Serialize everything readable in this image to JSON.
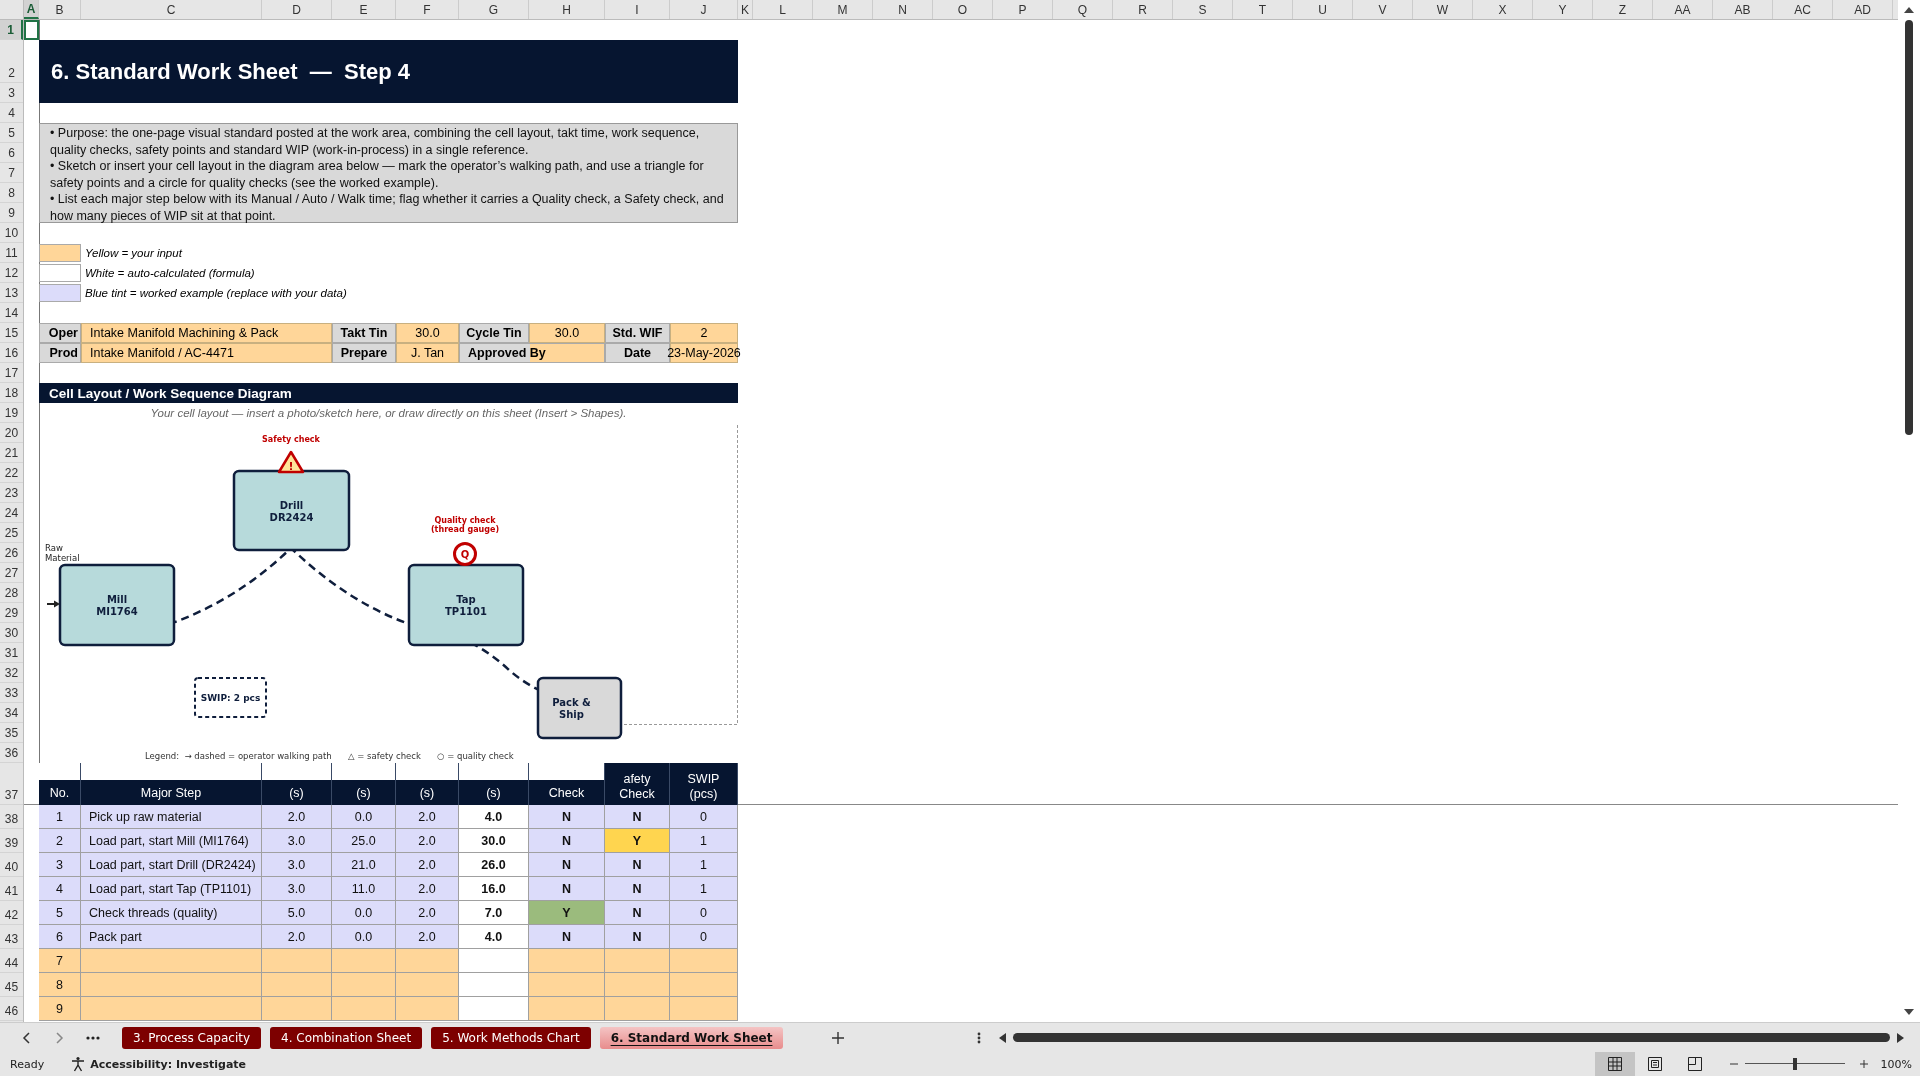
{
  "columns": [
    "A",
    "B",
    "C",
    "D",
    "E",
    "F",
    "G",
    "H",
    "I",
    "J",
    "K",
    "L",
    "M",
    "N",
    "O",
    "P",
    "Q",
    "R",
    "S",
    "T",
    "U",
    "V",
    "W",
    "X",
    "Y",
    "Z",
    "AA",
    "AB",
    "AC",
    "AD"
  ],
  "row_numbers": [
    "1",
    "2",
    "3",
    "4",
    "5",
    "6",
    "7",
    "8",
    "9",
    "10",
    "11",
    "12",
    "13",
    "14",
    "15",
    "16",
    "17",
    "18",
    "19",
    "20",
    "21",
    "22",
    "23",
    "24",
    "25",
    "26",
    "27",
    "28",
    "29",
    "30",
    "31",
    "32",
    "33",
    "34",
    "35",
    "36",
    "37",
    "38",
    "39",
    "40",
    "41",
    "42",
    "43",
    "44",
    "45",
    "46"
  ],
  "title": "6. Standard Work Sheet  —  Step 4",
  "instructions": [
    "•  Purpose: the one-page visual standard posted at the work area, combining the cell layout, takt time, work sequence, quality checks, safety points and standard WIP (work-in-process) in a single reference.",
    "•  Sketch or insert your cell layout in the diagram area below — mark the operator’s walking path, and use a triangle for safety points and a circle for quality checks (see the worked example).",
    "•  List each major step below with its Manual / Auto / Walk time; flag whether it carries a Quality check, a Safety check, and how many pieces of WIP sit at that point."
  ],
  "color_key": [
    {
      "color": "#ffd699",
      "text": "Yellow = your input"
    },
    {
      "color": "#ffffff",
      "text": "White = auto-calculated (formula)"
    },
    {
      "color": "#dcdcfa",
      "text": "Blue tint = worked example (replace with your data)"
    }
  ],
  "info_rows": [
    [
      {
        "label": "Oper",
        "value": "Intake Manifold Machining & Pack"
      },
      {
        "label": "Takt Tin",
        "value": "30.0"
      },
      {
        "label": "Cycle Tin",
        "value": "30.0"
      },
      {
        "label": "Std. WIF",
        "value": "2"
      }
    ],
    [
      {
        "label": "Prod",
        "value": "Intake Manifold / AC-4471"
      },
      {
        "label": "Prepare",
        "value": "J. Tan"
      },
      {
        "label": "Approved By"
      },
      {
        "label": "Date",
        "value": "23-May-2026"
      }
    ]
  ],
  "diagram": {
    "header": "Cell Layout / Work Sequence Diagram",
    "caption": "Your cell layout — insert a photo/sketch here, or draw directly on this sheet (Insert > Shapes).",
    "stations": [
      {
        "kind": "machine",
        "lines": [
          "Mill",
          "MI1764"
        ]
      },
      {
        "kind": "machine",
        "lines": [
          "Drill",
          "DR2424"
        ]
      },
      {
        "kind": "machine",
        "lines": [
          "Tap",
          "TP1101"
        ]
      },
      {
        "kind": "shipping",
        "lines": [
          "Pack &",
          "Ship"
        ]
      }
    ],
    "raw_material": [
      "Raw",
      "Material"
    ],
    "safety_label": "Safety check",
    "safety_symbol": "!",
    "quality_label": [
      "Quality check",
      "(thread gauge)"
    ],
    "quality_symbol": "Q",
    "swip_label": "SWIP: 2 pcs",
    "legend": "Legend:  → dashed = operator walking path      △ = safety check      ○ = quality check"
  },
  "table": {
    "columns": [
      "No.",
      "Major Step",
      "(s)",
      "(s)",
      "(s)",
      "(s)",
      "Check",
      "afety\nCheck",
      "SWIP\n(pcs)"
    ],
    "rows": [
      {
        "kind": "example",
        "no": "1",
        "step": "Pick up raw material",
        "manual": "2.0",
        "auto": "0.0",
        "walk": "2.0",
        "total": "4.0",
        "quality": {
          "text": "N",
          "flagged": false
        },
        "safety": {
          "text": "N",
          "flagged": false
        },
        "swip": "0"
      },
      {
        "kind": "example",
        "no": "2",
        "step": "Load part, start Mill (MI1764)",
        "manual": "3.0",
        "auto": "25.0",
        "walk": "2.0",
        "total": "30.0",
        "quality": {
          "text": "N",
          "flagged": false
        },
        "safety": {
          "text": "Y",
          "flagged": true
        },
        "swip": "1"
      },
      {
        "kind": "example",
        "no": "3",
        "step": "Load part, start Drill (DR2424)",
        "manual": "3.0",
        "auto": "21.0",
        "walk": "2.0",
        "total": "26.0",
        "quality": {
          "text": "N",
          "flagged": false
        },
        "safety": {
          "text": "N",
          "flagged": false
        },
        "swip": "1"
      },
      {
        "kind": "example",
        "no": "4",
        "step": "Load part, start Tap (TP1101)",
        "manual": "3.0",
        "auto": "11.0",
        "walk": "2.0",
        "total": "16.0",
        "quality": {
          "text": "N",
          "flagged": false
        },
        "safety": {
          "text": "N",
          "flagged": false
        },
        "swip": "1"
      },
      {
        "kind": "example",
        "no": "5",
        "step": "Check threads (quality)",
        "manual": "5.0",
        "auto": "0.0",
        "walk": "2.0",
        "total": "7.0",
        "quality": {
          "text": "Y",
          "flagged": true
        },
        "safety": {
          "text": "N",
          "flagged": false
        },
        "swip": "0"
      },
      {
        "kind": "example",
        "no": "6",
        "step": "Pack part",
        "manual": "2.0",
        "auto": "0.0",
        "walk": "2.0",
        "total": "4.0",
        "quality": {
          "text": "N",
          "flagged": false
        },
        "safety": {
          "text": "N",
          "flagged": false
        },
        "swip": "0"
      },
      {
        "kind": "input",
        "no": "7"
      },
      {
        "kind": "input",
        "no": "8"
      },
      {
        "kind": "input",
        "no": "9"
      }
    ]
  },
  "sheet_tabs": [
    {
      "label": "3. Process Capacity",
      "selected": false
    },
    {
      "label": "4. Combination Sheet",
      "selected": false
    },
    {
      "label": "5. Work Methods Chart",
      "selected": false
    },
    {
      "label": "6. Standard Work Sheet",
      "selected": true
    }
  ],
  "status_bar": {
    "status": "Ready",
    "accessibility": "Accessibility: Investigate",
    "views": [
      {
        "selected": true
      },
      {
        "selected": false
      },
      {
        "selected": false
      }
    ],
    "zoom": {
      "level": 0.5,
      "reading": "100%"
    }
  }
}
